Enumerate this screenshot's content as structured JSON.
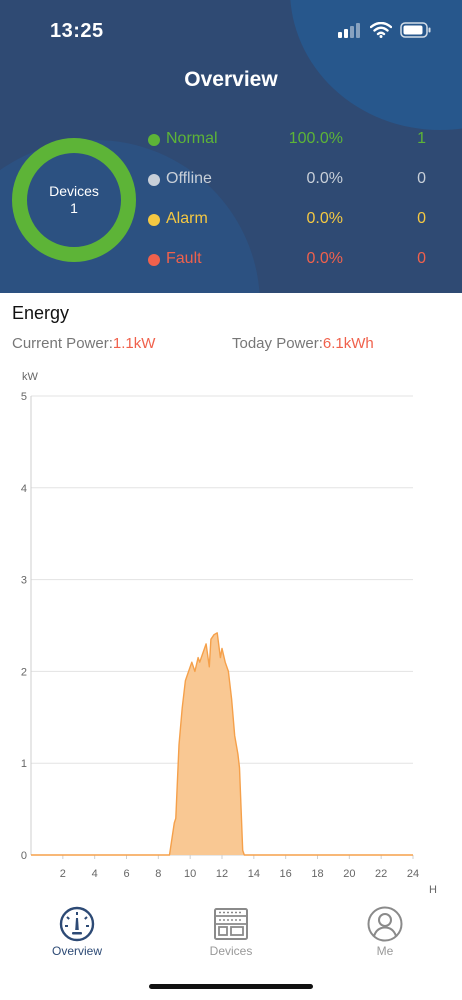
{
  "status_bar": {
    "time": "13:25"
  },
  "header": {
    "title": "Overview"
  },
  "summary": {
    "ring_label": "Devices",
    "ring_count": "1",
    "ring_color": "#5db437"
  },
  "status": [
    {
      "name": "Normal",
      "pct": "100.0%",
      "count": "1",
      "color": "#5db437",
      "dot": "#5db437"
    },
    {
      "name": "Offline",
      "pct": "0.0%",
      "count": "0",
      "color": "#c8cfd8",
      "dot": "#c8cfd8"
    },
    {
      "name": "Alarm",
      "pct": "0.0%",
      "count": "0",
      "color": "#f5c842",
      "dot": "#f5c842"
    },
    {
      "name": "Fault",
      "pct": "0.0%",
      "count": "0",
      "color": "#f0614c",
      "dot": "#f0614c"
    }
  ],
  "energy": {
    "title": "Energy",
    "current_label": "Current Power:",
    "current_value": "1.1kW",
    "today_label": "Today Power:",
    "today_value": "6.1kWh"
  },
  "chart_data": {
    "type": "area",
    "title": "",
    "xlabel": "H",
    "ylabel": "kW",
    "xlim": [
      0,
      24
    ],
    "ylim": [
      0,
      5
    ],
    "x_ticks": [
      "2",
      "4",
      "6",
      "8",
      "10",
      "12",
      "14",
      "16",
      "18",
      "20",
      "22",
      "24"
    ],
    "y_ticks": [
      "0",
      "1",
      "2",
      "3",
      "4",
      "5"
    ],
    "grid": true,
    "color": "#f5a04a",
    "fill": "#f9c893",
    "x": [
      0,
      8.7,
      9.0,
      9.1,
      9.3,
      9.5,
      9.7,
      9.9,
      10.1,
      10.3,
      10.5,
      10.6,
      10.8,
      11.0,
      11.2,
      11.3,
      11.5,
      11.7,
      11.9,
      12.0,
      12.2,
      12.4,
      12.6,
      12.8,
      13.0,
      13.1,
      13.2,
      13.3,
      13.4,
      24
    ],
    "y": [
      0,
      0,
      0.35,
      0.4,
      1.2,
      1.6,
      1.9,
      2.0,
      2.1,
      2.0,
      2.15,
      2.1,
      2.2,
      2.3,
      2.05,
      2.35,
      2.4,
      2.42,
      2.15,
      2.25,
      2.1,
      2.0,
      1.7,
      1.3,
      1.1,
      0.95,
      0.5,
      0.05,
      0,
      0
    ]
  },
  "tabs": [
    {
      "label": "Overview",
      "icon": "gauge-icon",
      "active": true
    },
    {
      "label": "Devices",
      "icon": "device-icon",
      "active": false
    },
    {
      "label": "Me",
      "icon": "person-icon",
      "active": false
    }
  ]
}
